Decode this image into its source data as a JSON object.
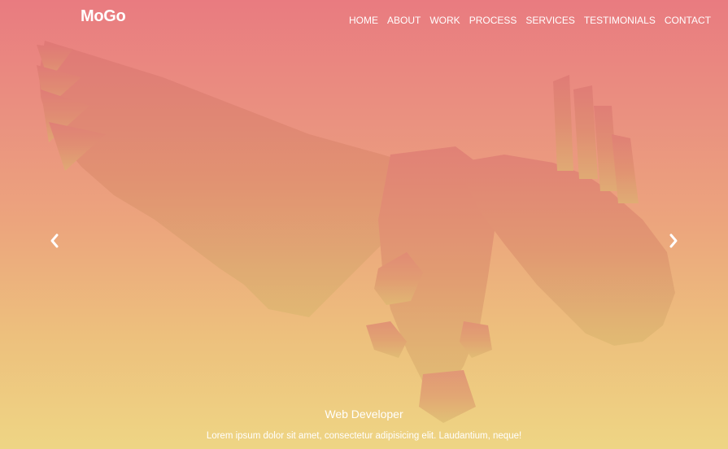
{
  "brand": {
    "logo": "MoGo"
  },
  "nav": {
    "items": [
      "HOME",
      "ABOUT",
      "WORK",
      "PROCESS",
      "SERVICES",
      "TESTIMONIALS",
      "CONTACT"
    ]
  },
  "slider": {
    "prev_icon": "chevron-left-icon",
    "next_icon": "chevron-right-icon",
    "caption_title": "Web Developer",
    "caption_text": "Lorem ipsum dolor sit amet, consectetur adipisicing elit. Laudantium, neque!"
  },
  "colors": {
    "gradient_top": "#e97b80",
    "gradient_bottom": "#eed584",
    "text": "#ffffff"
  }
}
